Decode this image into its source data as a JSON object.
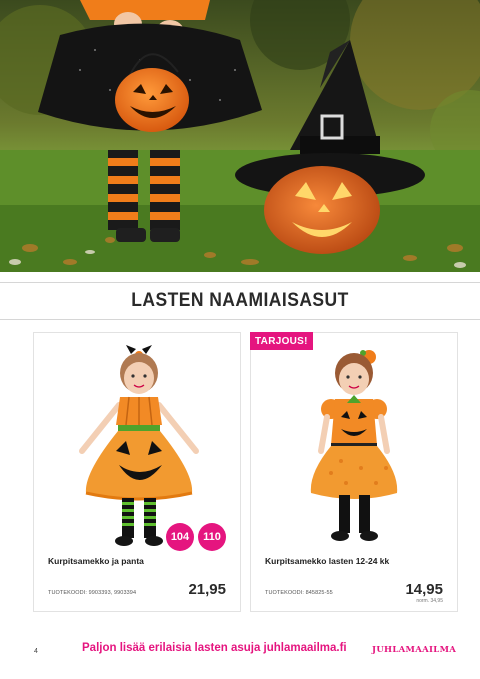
{
  "section": {
    "title": "LASTEN NAAMIAISASUT"
  },
  "products": [
    {
      "name": "Kurpitsamekko ja panta",
      "code": "TUOTEKOODI: 9903393, 9903394",
      "price": "21,95",
      "sizes": [
        "104",
        "110"
      ]
    },
    {
      "name": "Kurpitsamekko lasten 12-24 kk",
      "code": "TUOTEKOODI: 845825-55",
      "price": "14,95",
      "old_price": "norm. 34,95",
      "badge": "TARJOUS!"
    }
  ],
  "footer": {
    "page_number": "4",
    "link_text": "Paljon lisää erilaisia lasten asuja juhlamaailma.fi",
    "brand": "JUHLAMAAILMA"
  },
  "colors": {
    "accent": "#e5157f",
    "pumpkin": "#f07d1a"
  }
}
